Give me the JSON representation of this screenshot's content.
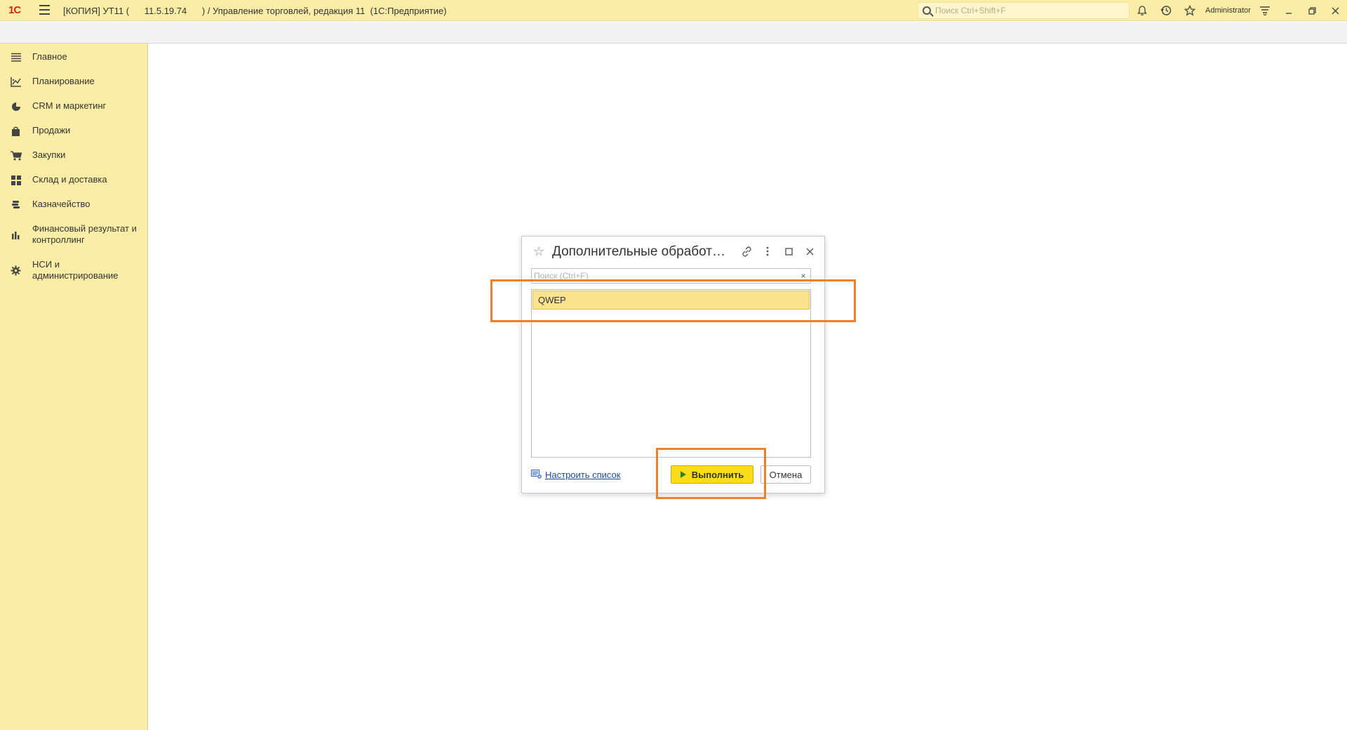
{
  "titlebar": {
    "logo": "1С",
    "title": "[КОПИЯ] УТ11 (      11.5.19.74      ) / Управление торговлей, редакция 11  (1С:Предприятие)",
    "search_placeholder": "Поиск Ctrl+Shift+F",
    "user": "Administrator"
  },
  "sidebar": {
    "items": [
      {
        "label": "Главное",
        "icon": "menu-lines-icon"
      },
      {
        "label": "Планирование",
        "icon": "chart-icon"
      },
      {
        "label": "CRM и маркетинг",
        "icon": "pie-icon"
      },
      {
        "label": "Продажи",
        "icon": "bag-icon"
      },
      {
        "label": "Закупки",
        "icon": "cart-icon"
      },
      {
        "label": "Склад и доставка",
        "icon": "grid-icon"
      },
      {
        "label": "Казначейство",
        "icon": "coins-icon"
      },
      {
        "label": "Финансовый результат и контроллинг",
        "icon": "bar-chart-icon"
      },
      {
        "label": "НСИ и администрирование",
        "icon": "gear-icon"
      }
    ]
  },
  "dialog": {
    "title": "Дополнительные обработ…",
    "search_placeholder": "Поиск (Ctrl+F)",
    "clear": "×",
    "list": [
      "QWEP"
    ],
    "configure_link": "Настроить список",
    "run_button": "Выполнить",
    "cancel_button": "Отмена"
  },
  "colors": {
    "panel": "#fbeda6",
    "selection": "#fbe28e",
    "primary_button": "#fbdc16",
    "annotation": "#f07f2a"
  }
}
